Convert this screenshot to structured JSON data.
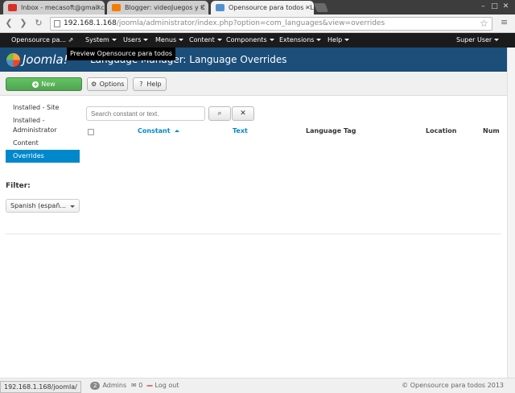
{
  "browser": {
    "tabs": [
      {
        "title": "Inbox - mecasoft@gmail.c",
        "favicon": "gmail-icon",
        "color": "#d93025"
      },
      {
        "title": "Blogger: videoJuegos y C",
        "favicon": "blogger-icon",
        "color": "#f57d00"
      },
      {
        "title": "Opensource para todos - L",
        "favicon": "joomla-icon",
        "color": "#5091cd"
      }
    ],
    "address": {
      "host": "192.168.1.168",
      "path": "/joomla/administrator/index.php?option=com_languages&view=overrides"
    },
    "link_preview": "192.168.1.168/joomla/"
  },
  "navbar": {
    "brand": "Opensource pa...",
    "menus": [
      "System",
      "Users",
      "Menus",
      "Content",
      "Components",
      "Extensions",
      "Help"
    ],
    "user_menu": "Super User",
    "tooltip": "Preview Opensource para todos"
  },
  "header": {
    "logo_text": "Joomla!",
    "title": "Language Manager: Language Overrides"
  },
  "toolbar": {
    "new_label": "New",
    "options_label": "Options",
    "help_label": "Help"
  },
  "sidebar": {
    "items": [
      "Installed - Site",
      "Installed - Administrator",
      "Content",
      "Overrides"
    ],
    "active_index": 3,
    "filter_label": "Filter:",
    "filter_value": "Spanish (españ..."
  },
  "search": {
    "placeholder": "Search constant or text."
  },
  "table": {
    "columns": [
      "Constant",
      "Text",
      "Language Tag",
      "Location",
      "Num"
    ]
  },
  "status": {
    "admins_count": "2",
    "admins_label": "Admins",
    "messages_count": "0",
    "logout_label": "Log out",
    "copyright": "© Opensource para todos 2013"
  }
}
